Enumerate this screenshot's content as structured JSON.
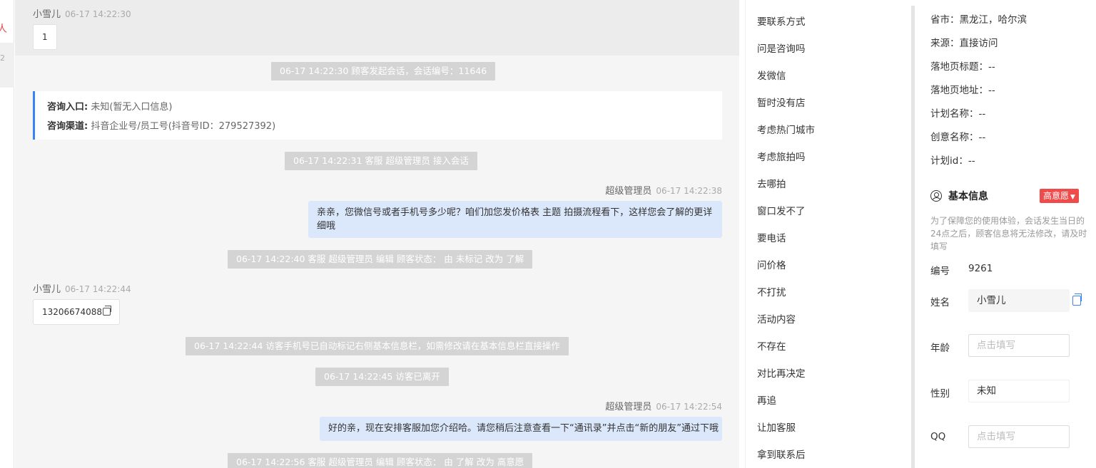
{
  "left_strip": {
    "text_top": "人",
    "text_bottom": "2"
  },
  "chat": {
    "msg1": {
      "sender": "小雪儿",
      "time": "06-17 14:22:30",
      "text": "1"
    },
    "sys1": "06-17 14:22:30 顾客发起会话，会话编号：11646",
    "card": {
      "entry_label": "咨询入口:",
      "entry_value": "未知(暂无入口信息)",
      "channel_label": "咨询渠道:",
      "channel_value": "抖音企业号/员工号(抖音号ID：279527392)"
    },
    "sys2": "06-17 14:22:31 客服 超级管理员 接入会话",
    "msg2": {
      "sender": "超级管理员",
      "time": "06-17 14:22:38",
      "text": "亲亲，您微信号或者手机号多少呢？咱们加您发价格表 主题 拍摄流程看下，这样您会了解的更详细哦"
    },
    "sys3": "06-17 14:22:40 客服 超级管理员 编辑 顾客状态： 由 未标记 改为 了解",
    "msg3": {
      "sender": "小雪儿",
      "time": "06-17 14:22:44",
      "text": "13206674088"
    },
    "sys4": "06-17 14:22:44 访客手机号已自动标记右侧基本信息栏，如需修改请在基本信息栏直接操作",
    "sys5": "06-17 14:22:45 访客已离开",
    "msg4": {
      "sender": "超级管理员",
      "time": "06-17 14:22:54",
      "text": "好的亲，现在安排客服加您介绍哈。请您稍后注意查看一下“通讯录”并点击“新的朋友”通过下哦"
    },
    "sys6": "06-17 14:22:56 客服 超级管理员 编辑 顾客状态： 由 了解 改为 高意愿"
  },
  "quick_replies": [
    "要联系方式",
    "问是咨询吗",
    "发微信",
    "暂时没有店",
    "考虑热门城市",
    "考虑旅拍吗",
    "去哪拍",
    "窗口发不了",
    "要电话",
    "问价格",
    "不打扰",
    "活动内容",
    "不存在",
    "对比再决定",
    "再追",
    "让加客服",
    "拿到联系后"
  ],
  "info": {
    "province": {
      "label": "省市：",
      "value": "黑龙江，哈尔滨"
    },
    "source": {
      "label": "来源：",
      "value": "直接访问"
    },
    "landing_title": {
      "label": "落地页标题：",
      "value": "--"
    },
    "landing_url": {
      "label": "落地页地址：",
      "value": "--"
    },
    "plan_name": {
      "label": "计划名称：",
      "value": "--"
    },
    "creative_name": {
      "label": "创意名称：",
      "value": "--"
    },
    "plan_id": {
      "label": "计划id：",
      "value": "--"
    }
  },
  "basic": {
    "title": "基本信息",
    "badge": "高意愿",
    "notice": "为了保障您的使用体验，会话发生当日的24点之后，顾客信息将无法修改，请及时填写",
    "id_label": "编号",
    "id_value": "9261",
    "name_label": "姓名",
    "name_value": "小雪儿",
    "age_label": "年龄",
    "age_placeholder": "点击填写",
    "gender_label": "性别",
    "gender_value": "未知",
    "qq_label": "QQ",
    "qq_placeholder": "点击填写"
  },
  "colors": {
    "accent": "#3b82f6",
    "badge": "#ef4b4b",
    "out_bubble": "#dbe8fb",
    "system": "#d4d4d4"
  }
}
